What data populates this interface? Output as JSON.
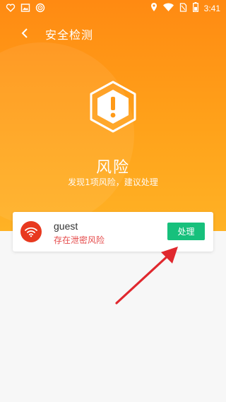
{
  "statusbar": {
    "time": "3:41",
    "left_icons": [
      "heart-icon",
      "image-icon",
      "swirl-icon"
    ],
    "right_icons": [
      "location-icon",
      "wifi-icon",
      "no-sim-icon",
      "battery-icon"
    ]
  },
  "header": {
    "title": "安全检测",
    "back_icon": "chevron-left-icon"
  },
  "hero": {
    "icon": "shield-warning-icon",
    "status_title": "风险",
    "status_subtitle": "发现1项风险，建议处理"
  },
  "risk_list": [
    {
      "name": "guest",
      "status": "存在泄密风险",
      "icon": "wifi-icon",
      "action_label": "处理"
    }
  ],
  "colors": {
    "header_orange": "#ff8a12",
    "risk_red": "#e8391f",
    "status_red": "#e54b4b",
    "action_green": "#17c07c",
    "arrow_red": "#e0282e",
    "page_background": "#f7f7f7"
  }
}
